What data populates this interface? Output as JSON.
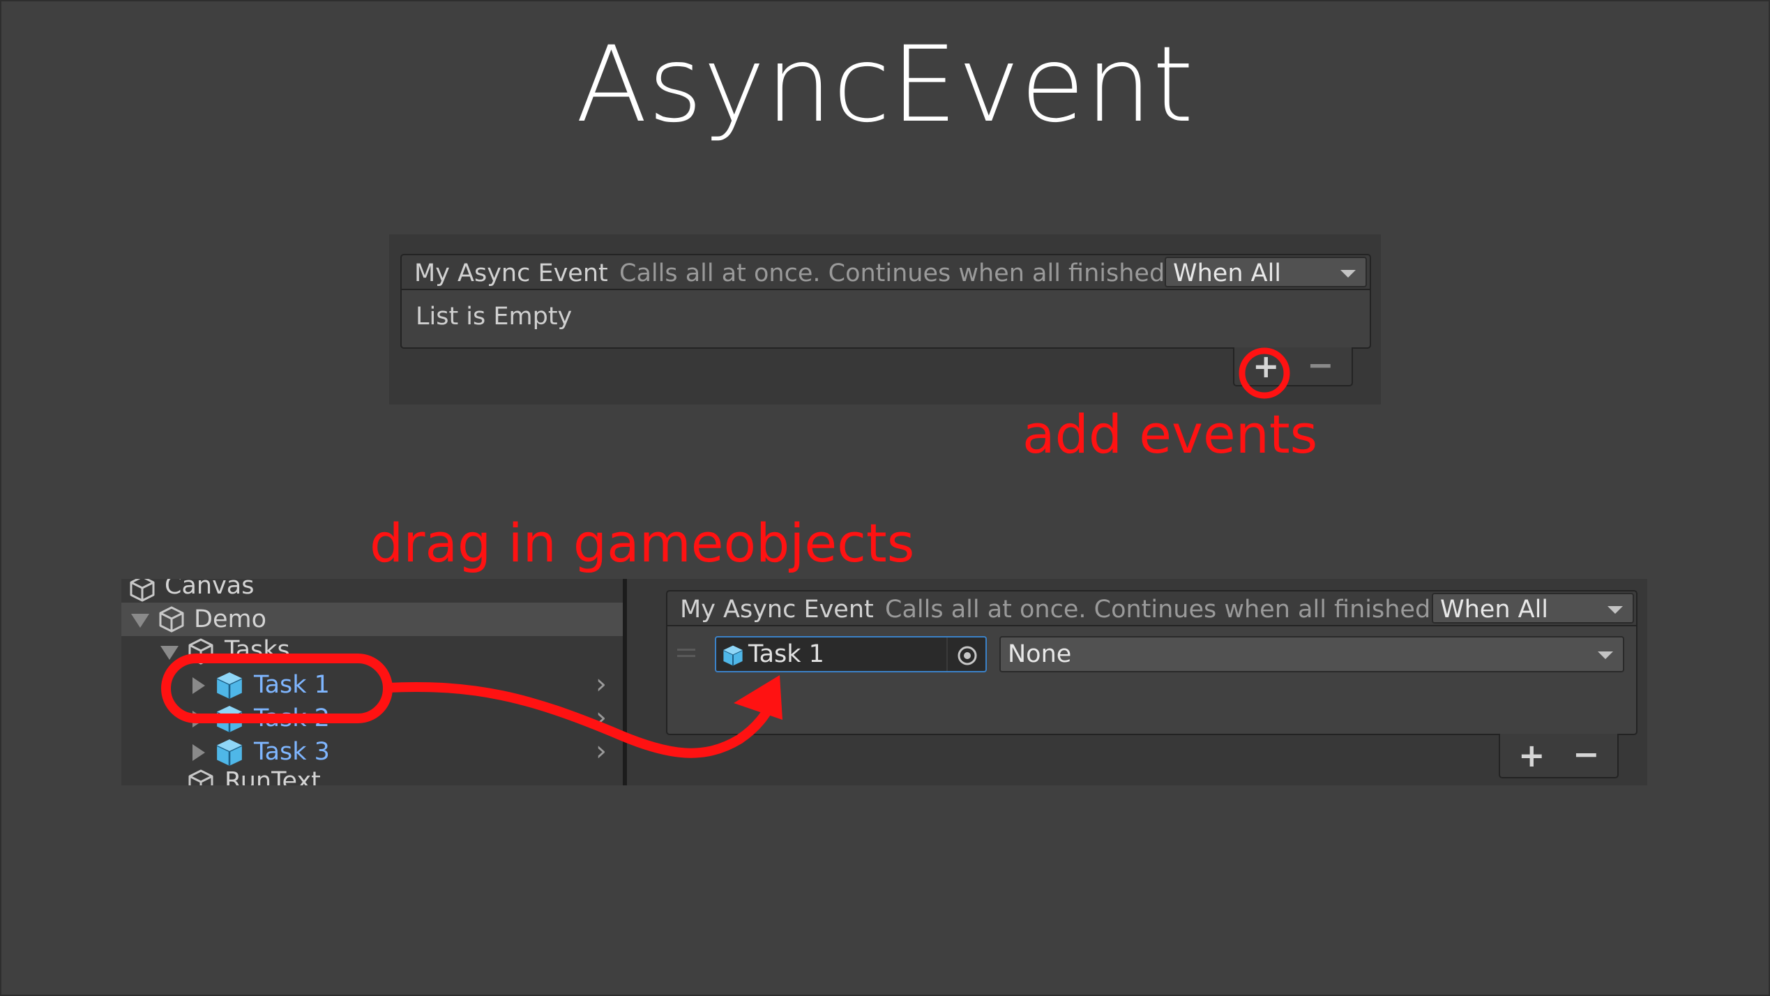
{
  "title": "AsyncEvent",
  "top_panel": {
    "event_name": "My Async Event",
    "description": "Calls all at once. Continues when all finished.",
    "mode": "When All",
    "empty_text": "List is Empty",
    "add_symbol": "+",
    "remove_symbol": "−"
  },
  "annotations": {
    "add_events": "add events",
    "drag_in": "drag in gameobjects"
  },
  "hierarchy": {
    "items": [
      {
        "label": "Canvas"
      },
      {
        "label": "Demo"
      },
      {
        "label": "Tasks"
      },
      {
        "label": "Task 1"
      },
      {
        "label": "Task 2"
      },
      {
        "label": "Task 3"
      },
      {
        "label": "RunText"
      }
    ]
  },
  "bottom_panel": {
    "event_name": "My Async Event",
    "description": "Calls all at once. Continues when all finished.",
    "mode": "When All",
    "object_field_value": "Task 1",
    "function_dropdown_value": "None",
    "add_symbol": "+",
    "remove_symbol": "−"
  },
  "colors": {
    "background": "#404040",
    "annotation": "#ff1212",
    "selected_text": "#7fb6ff",
    "prefab_icon": "#4fb7e8"
  }
}
